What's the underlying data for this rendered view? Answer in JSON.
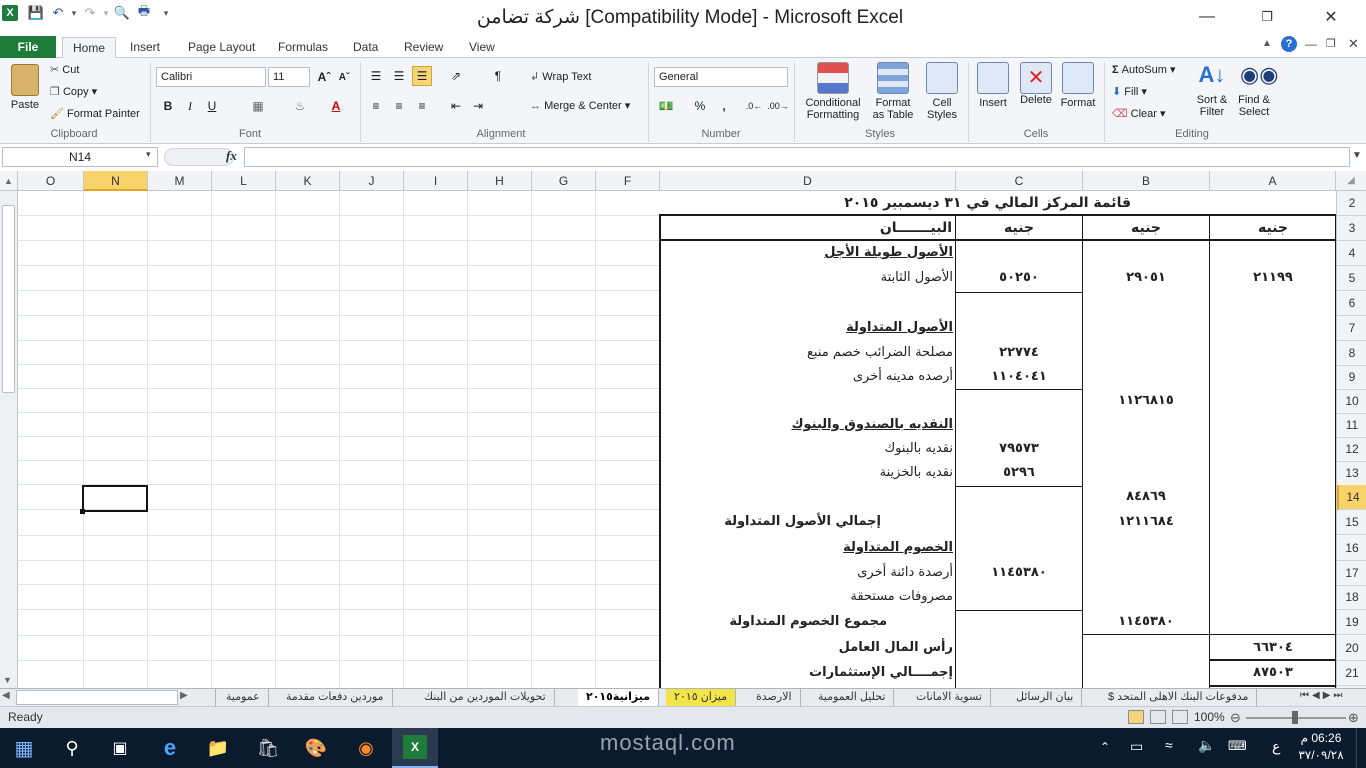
{
  "title": {
    "text": "شركة تضامن  [Compatibility Mode]  -  Microsoft Excel",
    "qat_icons": [
      "excel-icon",
      "save-icon",
      "undo-icon",
      "redo-icon",
      "print-preview-icon",
      "print-icon",
      "customize-icon"
    ]
  },
  "tabs": {
    "file": "File",
    "items": [
      "Home",
      "Insert",
      "Page Layout",
      "Formulas",
      "Data",
      "Review",
      "View"
    ],
    "active": "Home"
  },
  "ribbon": {
    "clipboard": {
      "paste": "Paste",
      "cut": "Cut",
      "copy": "Copy",
      "format_painter": "Format Painter",
      "label": "Clipboard"
    },
    "font": {
      "name": "Calibri",
      "size": "11",
      "label": "Font",
      "bold": "B",
      "italic": "I",
      "underline": "U"
    },
    "alignment": {
      "wrap": "Wrap Text",
      "merge": "Merge & Center",
      "label": "Alignment"
    },
    "number": {
      "format": "General",
      "label": "Number",
      "percent": "%",
      "comma": ","
    },
    "styles": {
      "conditional": "Conditional",
      "conditional2": "Formatting",
      "format_table": "Format",
      "format_table2": "as Table",
      "cell_styles": "Cell",
      "cell_styles2": "Styles",
      "label": "Styles"
    },
    "cells": {
      "insert": "Insert",
      "delete": "Delete",
      "format": "Format",
      "label": "Cells"
    },
    "editing": {
      "autosum": "AutoSum",
      "fill": "Fill",
      "clear": "Clear",
      "sort": "Sort &",
      "sort2": "Filter",
      "find": "Find &",
      "find2": "Select",
      "label": "Editing"
    }
  },
  "formula_bar": {
    "name_box": "N14",
    "fx": "fx",
    "value": ""
  },
  "columns": [
    "O",
    "N",
    "M",
    "L",
    "K",
    "J",
    "I",
    "H",
    "G",
    "F",
    "D",
    "C",
    "B",
    "A"
  ],
  "active_column": "N",
  "rows": [
    "2",
    "3",
    "4",
    "5",
    "6",
    "7",
    "8",
    "9",
    "10",
    "11",
    "12",
    "13",
    "14",
    "15",
    "16",
    "17",
    "18",
    "19",
    "20",
    "21"
  ],
  "active_row": "14",
  "sheet": {
    "title_row": "قائمة المركز المالي في ٣١ ديسمبير ٢٠١٥",
    "header": {
      "d": "البيـــــــان",
      "c": "جنيه",
      "b": "جنيه",
      "a": "جنيه"
    },
    "lines": [
      {
        "row": "4",
        "d": "الأصول طويلة الأجل",
        "style": "bu"
      },
      {
        "row": "5",
        "d": "الأصول الثابتة",
        "c": "٥٠٢٥٠",
        "b": "٢٩٠٥١",
        "a": "٢١١٩٩"
      },
      {
        "row": "7",
        "d": "الأصول المتداولة",
        "style": "bu"
      },
      {
        "row": "8",
        "d": "مصلحة الضرائب خصم منبع",
        "c": "٢٢٧٧٤"
      },
      {
        "row": "9",
        "d": "أرصده مدينه أخرى",
        "c": "١١٠٤٠٤١"
      },
      {
        "row": "10",
        "b": "١١٢٦٨١٥"
      },
      {
        "row": "11",
        "d": "النقديه بالصندوق والبنوك",
        "style": "bu"
      },
      {
        "row": "12",
        "d": "نقديه بالبنوك",
        "c": "٧٩٥٧٣"
      },
      {
        "row": "13",
        "d": "نقديه بالخزينة",
        "c": "٥٢٩٦"
      },
      {
        "row": "14",
        "b": "٨٤٨٦٩"
      },
      {
        "row": "15",
        "d": "إجمالي الأصول المتداولة",
        "style": "b",
        "b": "١٢١١٦٨٤"
      },
      {
        "row": "16",
        "d": "الخصوم المتداولة",
        "style": "bu"
      },
      {
        "row": "17",
        "d": "أرصدة دائنة أخرى",
        "c": "١١٤٥٣٨٠"
      },
      {
        "row": "18",
        "d": "مصروفات مستحقة"
      },
      {
        "row": "19",
        "d": "مجموع الخصوم المتداولة",
        "style": "b",
        "b": "١١٤٥٣٨٠"
      },
      {
        "row": "20",
        "d": "رأس المال العامل",
        "style": "b",
        "a": "٦٦٣٠٤"
      },
      {
        "row": "21",
        "d": "إجمــــالي الإستثمارات",
        "style": "b",
        "a": "٨٧٥٠٣"
      }
    ]
  },
  "sheet_tabs": [
    "مدفوعات البنك الاهلى المتحد $",
    "بيان الرسائل",
    "تسوية الامانات",
    "تحليل العمومية",
    "الارصدة",
    "ميزان ٢٠١٥",
    "ميزانية٢٠١٥",
    "تحويلات الموردين من البنك",
    "موردين دفعات مقدمة",
    "عمومية"
  ],
  "active_sheet_tab": "ميزانية٢٠١٥",
  "highlighted_sheet_tab": "ميزان ٢٠١٥",
  "status": {
    "ready": "Ready",
    "zoom": "100%"
  },
  "taskbar": {
    "time": "06:26 م",
    "date": "٣٧/٠٩/٢٨",
    "lang": "ع",
    "watermark": "mostaql.com"
  }
}
